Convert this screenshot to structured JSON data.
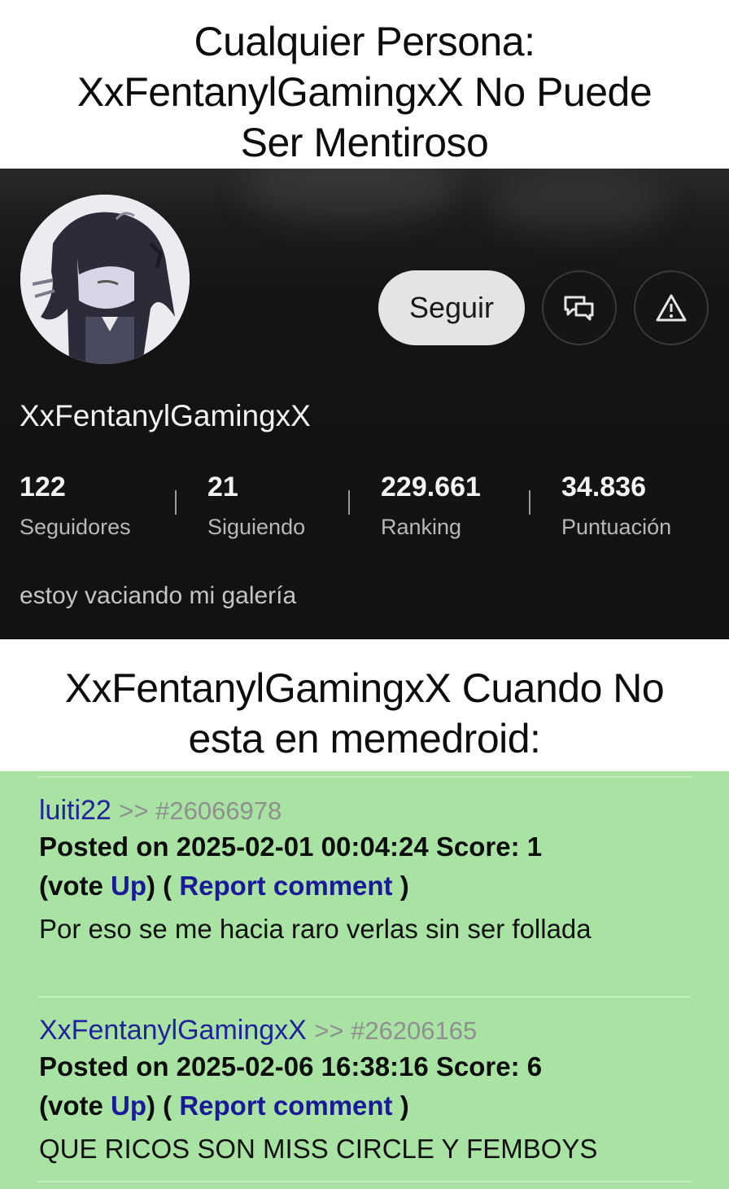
{
  "caption_top": {
    "line1": "Cualquier Persona:",
    "line2": "XxFentanylGamingxX No Puede",
    "line3": "Ser Mentiroso"
  },
  "profile": {
    "follow_label": "Seguir",
    "message_icon": "chat-bubbles-icon",
    "report_icon": "warning-triangle-icon",
    "username": "XxFentanylGamingxX",
    "stats": [
      {
        "value": "122",
        "label": "Seguidores"
      },
      {
        "value": "21",
        "label": "Siguiendo"
      },
      {
        "value": "229.661",
        "label": "Ranking"
      },
      {
        "value": "34.836",
        "label": "Puntuación"
      }
    ],
    "bio": "estoy vaciando mi galería"
  },
  "caption_mid": {
    "line1": "XxFentanylGamingxX Cuando No",
    "line2": "esta en memedroid:"
  },
  "comments": [
    {
      "author": "luiti22",
      "ref": ">> #26066978",
      "meta": "Posted on 2025-02-01 00:04:24 Score: 1",
      "vote_open": "(vote ",
      "vote_link": "Up",
      "vote_close": ") ( ",
      "report_link": "Report comment",
      "report_close": " )",
      "body": "Por eso se me hacia raro verlas sin ser follada"
    },
    {
      "author": "XxFentanylGamingxX",
      "ref": ">> #26206165",
      "meta": "Posted on 2025-02-06 16:38:16 Score: 6",
      "vote_open": "(vote ",
      "vote_link": "Up",
      "vote_close": ") ( ",
      "report_link": "Report comment",
      "report_close": " )",
      "body": "QUE RICOS SON MISS CIRCLE Y FEMBOYS"
    }
  ]
}
